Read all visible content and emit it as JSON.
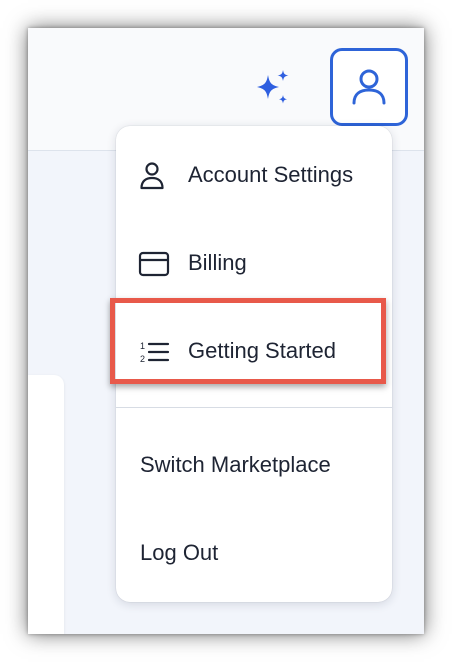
{
  "header": {
    "ai_icon": "sparkles-icon",
    "profile_icon": "user-icon",
    "accent_color": "#2e64d8"
  },
  "menu": {
    "items": [
      {
        "label": "Account Settings",
        "icon": "user-icon"
      },
      {
        "label": "Billing",
        "icon": "credit-card-icon"
      },
      {
        "label": "Getting Started",
        "icon": "numbered-list-icon"
      },
      {
        "label": "Switch Marketplace"
      },
      {
        "label": "Log Out"
      }
    ]
  },
  "annotation": {
    "highlight_color": "#e8594a",
    "highlighted_item": "Getting Started"
  }
}
